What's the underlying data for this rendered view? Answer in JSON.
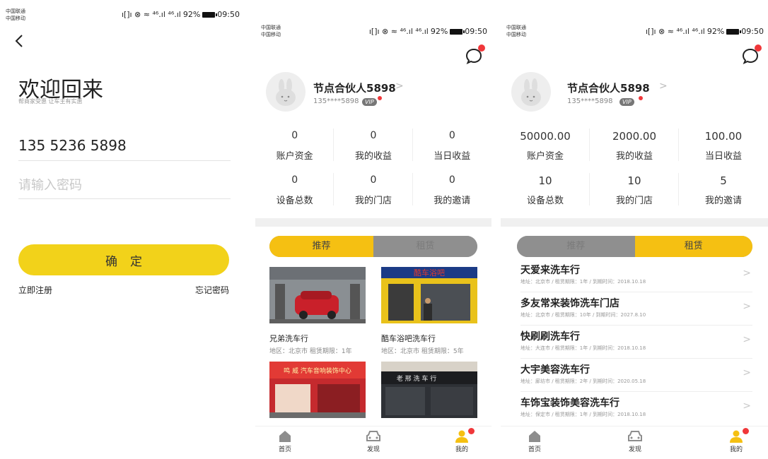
{
  "status_bar": {
    "carrier_1": "中国联通",
    "carrier_2": "中国移动",
    "icons_text": "ı[]ı ⊗ ≈ ⁴⁶.ıl ⁴⁶.ıl",
    "battery_pct": "92%",
    "time": "09:50"
  },
  "login": {
    "title": "欢迎回来",
    "subtitle": "帮商家受惠 让车主有实惠",
    "phone_value": "135  5236  5898",
    "password_placeholder": "请输入密码",
    "confirm_label": "确定",
    "register_link": "立即注册",
    "forgot_link": "忘记密码"
  },
  "profile_empty": {
    "username": "节点合伙人5898",
    "phone_masked": "135****5898",
    "vip_label": "VIP",
    "stats": [
      {
        "value": "0",
        "label": "账户资金"
      },
      {
        "value": "0",
        "label": "我的收益"
      },
      {
        "value": "0",
        "label": "当日收益"
      },
      {
        "value": "0",
        "label": "设备总数"
      },
      {
        "value": "0",
        "label": "我的门店"
      },
      {
        "value": "0",
        "label": "我的邀请"
      }
    ],
    "tabs": [
      "推荐",
      "租赁"
    ],
    "active_tab": "推荐",
    "shops": [
      {
        "name": "兄弟洗车行",
        "meta": "地区：北京市    租赁期限：1年"
      },
      {
        "name": "酷车浴吧洗车行",
        "meta": "地区：北京市    租赁期限：5年"
      },
      {
        "name": "",
        "meta": ""
      },
      {
        "name": "",
        "meta": ""
      }
    ],
    "shop_sign_3": "鸣 威  汽车音响装饰中心",
    "shop_sign_2": "酷车浴吧",
    "shop_sign_4": "老 邢 洗 车 行"
  },
  "profile_full": {
    "username": "节点合伙人5898",
    "phone_masked": "135****5898",
    "vip_label": "VIP",
    "stats": [
      {
        "value": "50000.00",
        "label": "账户资金"
      },
      {
        "value": "2000.00",
        "label": "我的收益"
      },
      {
        "value": "100.00",
        "label": "当日收益"
      },
      {
        "value": "10",
        "label": "设备总数"
      },
      {
        "value": "10",
        "label": "我的门店"
      },
      {
        "value": "5",
        "label": "我的邀请"
      }
    ],
    "tabs": [
      "推荐",
      "租赁"
    ],
    "active_tab": "租赁",
    "rentals": [
      {
        "name": "天爱来洗车行",
        "meta": "地址：北京市  /  租赁期限：1年  /  到期时间：2018.10.18"
      },
      {
        "name": "多友常来装饰洗车门店",
        "meta": "地址：北京市  /  租赁期限：10年  /  到期时间：2027.8.10"
      },
      {
        "name": "快刷刷洗车行",
        "meta": "地址：大连市  /  租赁期限：1年  /  到期时间：2018.10.18"
      },
      {
        "name": "大宇美容洗车行",
        "meta": "地址：廊坊市  /  租赁期限：2年  /  到期时间：2020.05.18"
      },
      {
        "name": "车饰宝装饰美容洗车行",
        "meta": "地址：保定市  /  租赁期限：1年  /  到期时间：2018.10.18"
      }
    ]
  },
  "bottom_nav": [
    {
      "label": "首页",
      "icon": "home-icon"
    },
    {
      "label": "发现",
      "icon": "car-icon"
    },
    {
      "label": "我的",
      "icon": "user-icon"
    }
  ],
  "colors": {
    "accent_yellow": "#f2d21a",
    "tab_yellow": "#f5c012",
    "badge_red": "#f0373a"
  }
}
